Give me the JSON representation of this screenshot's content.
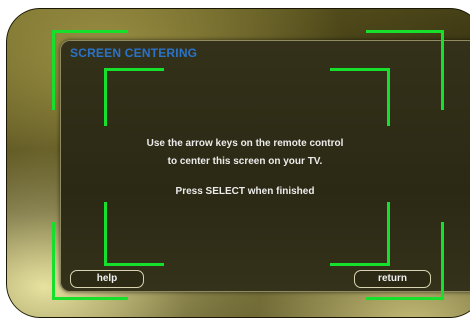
{
  "screen": {
    "title": "SCREEN CENTERING",
    "instructions": {
      "line1": "Use the arrow keys on the remote control",
      "line2": "to center this screen on your TV.",
      "line3": "Press SELECT when finished"
    }
  },
  "buttons": {
    "help": "help",
    "return": "return"
  },
  "colors": {
    "guide": "#16e02b",
    "title": "#2a73c9",
    "text": "#ececec"
  }
}
